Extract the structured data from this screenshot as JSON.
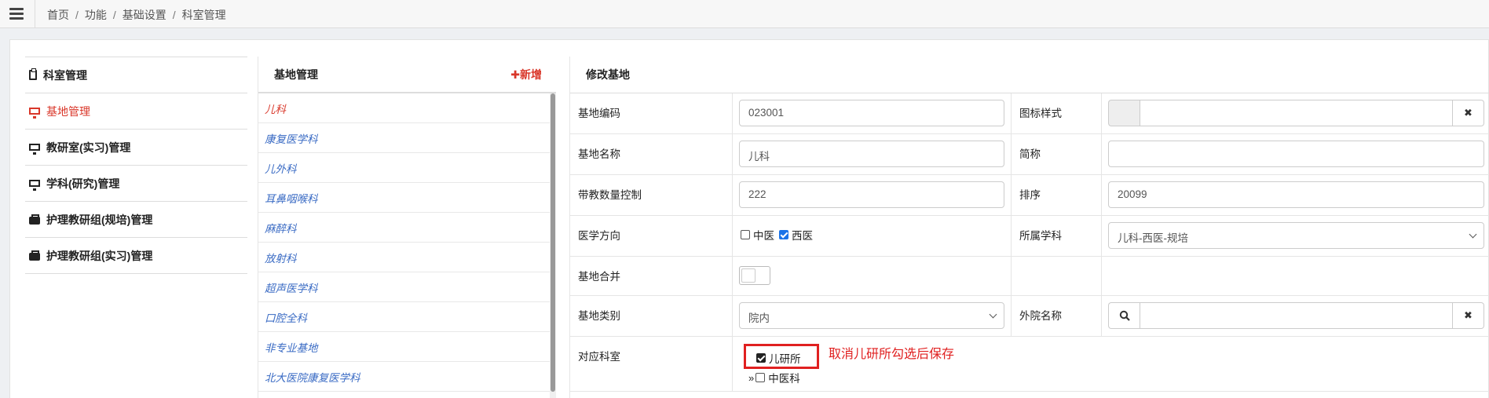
{
  "breadcrumb": [
    "首页",
    "功能",
    "基础设置",
    "科室管理"
  ],
  "menu": [
    {
      "label": "科室管理",
      "icon": "clipboard-icon",
      "active": false
    },
    {
      "label": "基地管理",
      "icon": "monitor-icon",
      "active": true
    },
    {
      "label": "教研室(实习)管理",
      "icon": "monitor-icon",
      "active": false
    },
    {
      "label": "学科(研究)管理",
      "icon": "monitor-icon",
      "active": false
    },
    {
      "label": "护理教研组(规培)管理",
      "icon": "briefcase-icon",
      "active": false
    },
    {
      "label": "护理教研组(实习)管理",
      "icon": "briefcase-icon",
      "active": false
    }
  ],
  "base_list": {
    "title": "基地管理",
    "add_label": "✚新增",
    "items": [
      "儿科",
      "康复医学科",
      "儿外科",
      "耳鼻咽喉科",
      "麻醉科",
      "放射科",
      "超声医学科",
      "口腔全科",
      "非专业基地",
      "北大医院康复医学科"
    ]
  },
  "form": {
    "title": "修改基地",
    "code_label": "基地编码",
    "code_value": "023001",
    "icon_style_label": "图标样式",
    "name_label": "基地名称",
    "name_value": "儿科",
    "abbr_label": "简称",
    "abbr_value": "",
    "count_label": "带教数量控制",
    "count_value": "222",
    "order_label": "排序",
    "order_value": "20099",
    "direction_label": "医学方向",
    "direction_options": [
      {
        "label": "中医",
        "checked": false
      },
      {
        "label": "西医",
        "checked": true
      }
    ],
    "discipline_label": "所属学科",
    "discipline_value": "儿科-西医-规培",
    "merge_label": "基地合并",
    "merge_on": false,
    "type_label": "基地类别",
    "type_value": "院内",
    "external_label": "外院名称",
    "external_value": "",
    "dept_label": "对应科室",
    "depts": [
      {
        "label": "儿研所",
        "checked": true
      },
      {
        "label": "中医科",
        "checked": false
      }
    ],
    "annotation": "取消儿研所勾选后保存"
  },
  "colors": {
    "accent": "#d9372a",
    "link": "#3a6bc4",
    "annotation": "#e02020"
  }
}
